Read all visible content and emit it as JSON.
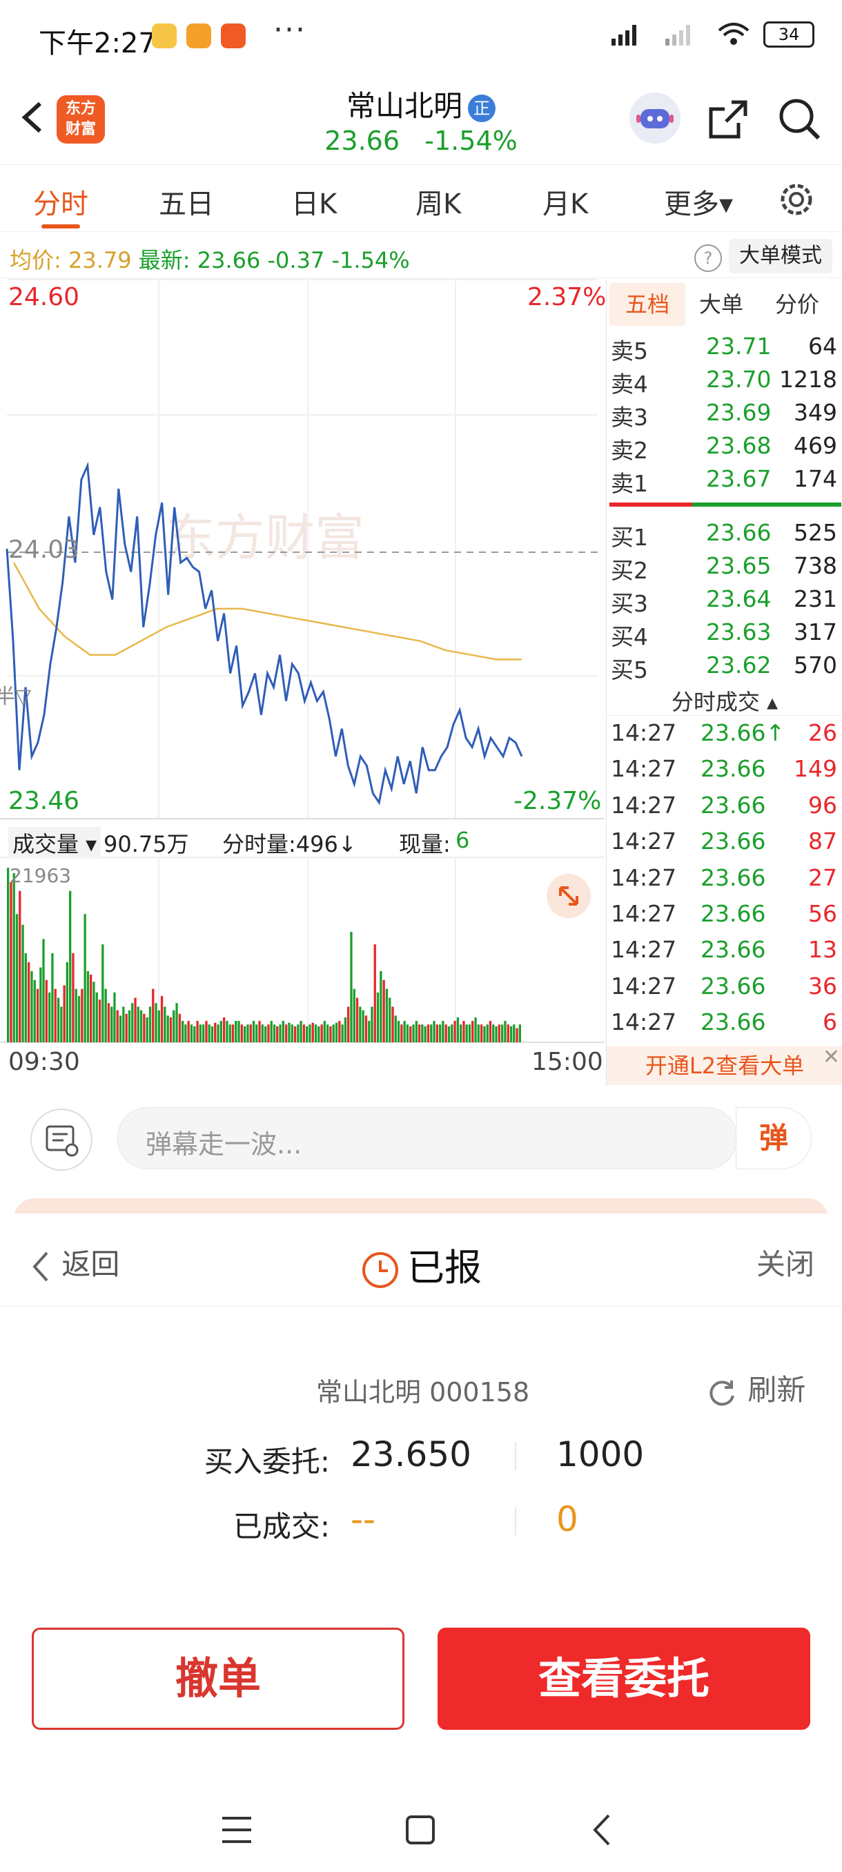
{
  "status_bar": {
    "time": "下午2:27",
    "more": "···",
    "battery": "34"
  },
  "header": {
    "logo_text": "东方\n财富",
    "stock_name": "常山北明",
    "badge": "正",
    "price": "23.66",
    "change_pct": "-1.54%"
  },
  "tabs": [
    {
      "label": "分时"
    },
    {
      "label": "五日"
    },
    {
      "label": "日K"
    },
    {
      "label": "周K"
    },
    {
      "label": "月K"
    },
    {
      "label": "更多▾"
    }
  ],
  "info_row": {
    "avg_label": "均价:",
    "avg_value": "23.79",
    "latest_label": "最新:",
    "latest_value": "23.66",
    "change": "-0.37",
    "change_pct": "-1.54%",
    "help": "?",
    "big_mode": "大单模式"
  },
  "chart": {
    "price_high": "24.60",
    "price_low": "23.46",
    "pct_high": "2.37%",
    "pct_low": "-2.37%",
    "ref_price": "24.03",
    "watermark": "东方财富",
    "left_edge_label": "半▽",
    "vol_label": "成交量 ▾",
    "vol_total": "90.75万",
    "vol_minute": "分时量:496↓",
    "vol_now_label": "现量:",
    "vol_now": "6",
    "vol_max": "21963",
    "time_start": "09:30",
    "time_end": "15:00"
  },
  "chart_data": {
    "type": "line",
    "ylim": [
      23.46,
      24.6
    ],
    "reference": 24.03,
    "series": [
      {
        "values": [
          24.03,
          23.83,
          23.55,
          23.73,
          23.58,
          23.61,
          23.67,
          23.78,
          23.86,
          23.96,
          24.1,
          24.0,
          24.18,
          24.21,
          24.06,
          24.12,
          23.98,
          23.92,
          24.16,
          24.04,
          23.98,
          24.1,
          23.86,
          23.95,
          24.06,
          24.13,
          23.93,
          24.12,
          24.0,
          24.01,
          23.99,
          23.98,
          23.9,
          23.94,
          23.83,
          23.89,
          23.76,
          23.82,
          23.69,
          23.72,
          23.76,
          23.67,
          23.76,
          23.73,
          23.8,
          23.7,
          23.78,
          23.76,
          23.7,
          23.74,
          23.7,
          23.72,
          23.66,
          23.58,
          23.64,
          23.56,
          23.52,
          23.58,
          23.56,
          23.5,
          23.48,
          23.55,
          23.51,
          23.58,
          23.52,
          23.57,
          23.5,
          23.6,
          23.55,
          23.55,
          23.58,
          23.6,
          23.65,
          23.68,
          23.62,
          23.6,
          23.64,
          23.58,
          23.62,
          23.6,
          23.58,
          23.62,
          23.61,
          23.58
        ]
      },
      {
        "values": [
          24.0,
          23.9,
          23.84,
          23.8,
          23.8,
          23.83,
          23.86,
          23.88,
          23.9,
          23.9,
          23.89,
          23.88,
          23.87,
          23.86,
          23.85,
          23.84,
          23.83,
          23.81,
          23.8,
          23.79,
          23.79
        ]
      }
    ]
  },
  "volume_data": [
    0.98,
    0.9,
    0.95,
    0.72,
    0.85,
    0.66,
    0.5,
    0.45,
    0.4,
    0.35,
    0.3,
    0.42,
    0.58,
    0.35,
    0.28,
    0.5,
    0.3,
    0.25,
    0.2,
    0.32,
    0.45,
    0.85,
    0.5,
    0.3,
    0.26,
    0.3,
    0.72,
    0.4,
    0.38,
    0.34,
    0.28,
    0.24,
    0.55,
    0.3,
    0.22,
    0.2,
    0.28,
    0.18,
    0.15,
    0.2,
    0.16,
    0.18,
    0.22,
    0.25,
    0.2,
    0.18,
    0.16,
    0.14,
    0.2,
    0.3,
    0.22,
    0.18,
    0.26,
    0.2,
    0.15,
    0.14,
    0.18,
    0.22,
    0.16,
    0.12,
    0.1,
    0.12,
    0.1,
    0.09,
    0.12,
    0.1,
    0.1,
    0.12,
    0.1,
    0.09,
    0.11,
    0.1,
    0.12,
    0.14,
    0.12,
    0.1,
    0.1,
    0.12,
    0.12,
    0.1,
    0.09,
    0.1,
    0.1,
    0.12,
    0.1,
    0.12,
    0.1,
    0.09,
    0.1,
    0.12,
    0.1,
    0.09,
    0.1,
    0.12,
    0.1,
    0.11,
    0.1,
    0.09,
    0.1,
    0.12,
    0.1,
    0.09,
    0.1,
    0.11,
    0.1,
    0.09,
    0.1,
    0.12,
    0.1,
    0.09,
    0.1,
    0.11,
    0.12,
    0.1,
    0.14,
    0.2,
    0.62,
    0.3,
    0.25,
    0.2,
    0.18,
    0.15,
    0.12,
    0.2,
    0.55,
    0.28,
    0.4,
    0.35,
    0.3,
    0.25,
    0.2,
    0.15,
    0.12,
    0.1,
    0.12,
    0.1,
    0.09,
    0.1,
    0.12,
    0.1,
    0.1,
    0.09,
    0.1,
    0.1,
    0.12,
    0.1,
    0.1,
    0.12,
    0.1,
    0.09,
    0.1,
    0.12,
    0.14,
    0.1,
    0.12,
    0.1,
    0.1,
    0.12,
    0.14,
    0.1,
    0.1,
    0.09,
    0.1,
    0.12,
    0.1,
    0.09,
    0.1,
    0.1,
    0.12,
    0.1,
    0.09,
    0.1,
    0.08,
    0.1
  ],
  "panel": {
    "tabs": [
      {
        "label": "五档"
      },
      {
        "label": "大单"
      },
      {
        "label": "分价"
      }
    ],
    "sell": [
      {
        "label": "卖5",
        "price": "23.71",
        "vol": "64"
      },
      {
        "label": "卖4",
        "price": "23.70",
        "vol": "1218"
      },
      {
        "label": "卖3",
        "price": "23.69",
        "vol": "349"
      },
      {
        "label": "卖2",
        "price": "23.68",
        "vol": "469"
      },
      {
        "label": "卖1",
        "price": "23.67",
        "vol": "174"
      }
    ],
    "buy": [
      {
        "label": "买1",
        "price": "23.66",
        "vol": "525"
      },
      {
        "label": "买2",
        "price": "23.65",
        "vol": "738"
      },
      {
        "label": "买3",
        "price": "23.64",
        "vol": "231"
      },
      {
        "label": "买4",
        "price": "23.63",
        "vol": "317"
      },
      {
        "label": "买5",
        "price": "23.62",
        "vol": "570"
      }
    ],
    "trades_title": "分时成交 ▴",
    "trades": [
      {
        "time": "14:27",
        "price": "23.66↑",
        "vol": "26"
      },
      {
        "time": "14:27",
        "price": "23.66",
        "vol": "149"
      },
      {
        "time": "14:27",
        "price": "23.66",
        "vol": "96"
      },
      {
        "time": "14:27",
        "price": "23.66",
        "vol": "87"
      },
      {
        "time": "14:27",
        "price": "23.66",
        "vol": "27"
      },
      {
        "time": "14:27",
        "price": "23.66",
        "vol": "56"
      },
      {
        "time": "14:27",
        "price": "23.66",
        "vol": "13"
      },
      {
        "time": "14:27",
        "price": "23.66",
        "vol": "36"
      },
      {
        "time": "14:27",
        "price": "23.66",
        "vol": "6"
      }
    ],
    "l2_text": "开通L2查看大单"
  },
  "danmu": {
    "placeholder": "弹幕走一波...",
    "button": "弹"
  },
  "order_sheet": {
    "back": "返回",
    "status": "已报",
    "close": "关闭",
    "stock": "常山北明 000158",
    "refresh": "刷新",
    "entrust_label": "买入委托:",
    "entrust_price": "23.650",
    "entrust_qty": "1000",
    "filled_label": "已成交:",
    "filled_price": "--",
    "filled_qty": "0",
    "cancel": "撤单",
    "view": "查看委托"
  },
  "colors": {
    "accent": "#e8561b",
    "up": "#e8262b",
    "down": "#1a9f2b",
    "avg": "#e8b84a",
    "price_line": "#2f5db8"
  }
}
